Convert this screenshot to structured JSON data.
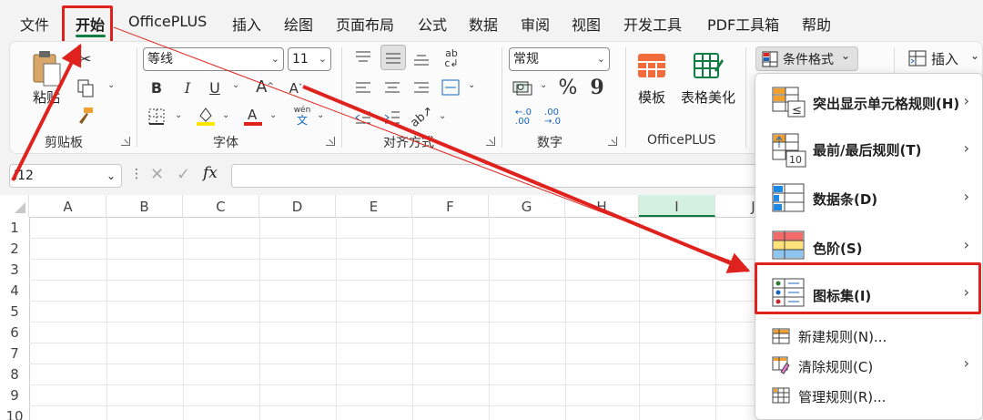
{
  "menu": {
    "items": [
      "文件",
      "开始",
      "OfficePLUS",
      "插入",
      "绘图",
      "页面布局",
      "公式",
      "数据",
      "审阅",
      "视图",
      "开发工具",
      "PDF工具箱",
      "帮助"
    ]
  },
  "ribbon": {
    "clipboard": {
      "paste_label": "粘贴",
      "group_label": "剪贴板"
    },
    "font": {
      "font_name": "等线",
      "font_size": "11",
      "group_label": "字体",
      "wen_top": "wén",
      "wen_bottom": "文"
    },
    "alignment": {
      "group_label": "对齐方式"
    },
    "number": {
      "format": "常规",
      "group_label": "数字",
      "percent": "%",
      "comma": "9",
      "inc_decimal": "←.0\n.00",
      "dec_decimal": ".00\n→.0"
    },
    "officeplus": {
      "template_label": "模板",
      "beautify_label": "表格美化",
      "group_label": "OfficePLUS"
    },
    "styles": {
      "conditional_format_label": "条件格式"
    },
    "cells": {
      "insert_label": "插入"
    }
  },
  "formula_bar": {
    "name_box": "I12",
    "fx": "fx"
  },
  "grid": {
    "columns": [
      "A",
      "B",
      "C",
      "D",
      "E",
      "F",
      "G",
      "H",
      "I",
      "J"
    ],
    "rows": [
      "1",
      "2",
      "3",
      "4",
      "5",
      "6",
      "7",
      "8",
      "9",
      "10"
    ],
    "selected_column": "I"
  },
  "dropdown": {
    "items": [
      {
        "label": "突出显示单元格规则(H)",
        "bold": true,
        "submenu": true
      },
      {
        "label": "最前/最后规则(T)",
        "bold": true,
        "submenu": true
      },
      {
        "label": "数据条(D)",
        "bold": true,
        "submenu": true
      },
      {
        "label": "色阶(S)",
        "bold": true,
        "submenu": true
      },
      {
        "label": "图标集(I)",
        "bold": true,
        "submenu": true
      },
      {
        "label": "新建规则(N)...",
        "bold": false,
        "submenu": false
      },
      {
        "label": "清除规则(C)",
        "bold": false,
        "submenu": true
      },
      {
        "label": "管理规则(R)...",
        "bold": false,
        "submenu": false
      }
    ],
    "icon_labels": {
      "top10": "10"
    }
  },
  "colors": {
    "accent": "#107c41",
    "highlight_red": "#e0221e",
    "highlight_yellow": "#ffe600",
    "font_red": "#e0221e"
  }
}
